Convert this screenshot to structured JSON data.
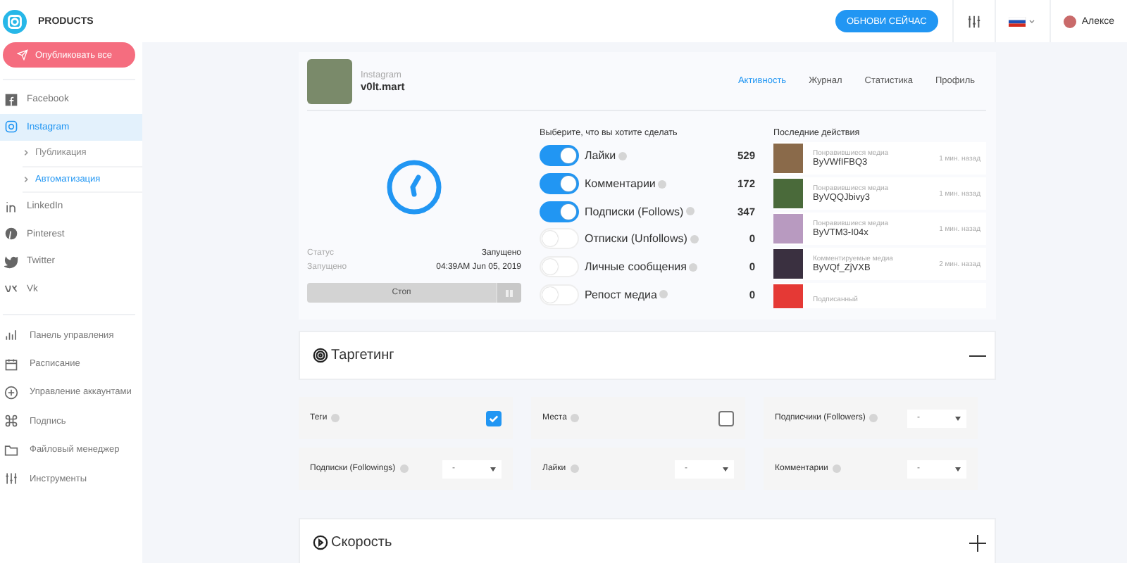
{
  "header": {
    "brand": "PRODUCTS",
    "update_button": "ОБНОВИ СЕЙЧАС",
    "user": "Алексе"
  },
  "sidebar": {
    "publish_button": "Опубликовать все",
    "networks": [
      {
        "label": "Facebook",
        "selected": false
      },
      {
        "label": "Instagram",
        "selected": true,
        "children": [
          {
            "label": "Публикация",
            "selected": false
          },
          {
            "label": "Автоматизация",
            "selected": true
          }
        ]
      },
      {
        "label": "LinkedIn",
        "selected": false
      },
      {
        "label": "Pinterest",
        "selected": false
      },
      {
        "label": "Twitter",
        "selected": false
      },
      {
        "label": "Vk",
        "selected": false
      }
    ],
    "tools": [
      {
        "label": "Панель управления"
      },
      {
        "label": "Расписание"
      },
      {
        "label": "Управление аккаунтами"
      },
      {
        "label": "Подпись"
      },
      {
        "label": "Файловый менеджер"
      },
      {
        "label": "Инструменты"
      }
    ]
  },
  "account": {
    "network": "Instagram",
    "username": "v0lt.mart"
  },
  "tabs": [
    {
      "label": "Активность",
      "selected": true
    },
    {
      "label": "Журнал",
      "selected": false
    },
    {
      "label": "Статистика",
      "selected": false
    },
    {
      "label": "Профиль",
      "selected": false
    }
  ],
  "status": [
    {
      "label": "Статус",
      "value": "Запущено"
    },
    {
      "label": "Запущено",
      "value": "04:39AM Jun 05, 2019"
    }
  ],
  "stop_button": "Стоп",
  "actions": {
    "title": "Выберите, что вы хотите сделать",
    "items": [
      {
        "label": "Лайки",
        "on": true,
        "count": "529"
      },
      {
        "label": "Комментарии",
        "on": true,
        "count": "172"
      },
      {
        "label": "Подписки (Follows)",
        "on": true,
        "count": "347"
      },
      {
        "label": "Отписки (Unfollows)",
        "on": false,
        "count": "0"
      },
      {
        "label": "Личные сообщения",
        "on": false,
        "count": "0"
      },
      {
        "label": "Репост медиа",
        "on": false,
        "count": "0"
      }
    ]
  },
  "recent": {
    "title": "Последние действия",
    "items": [
      {
        "type": "Понравившиеся медиа",
        "code": "ByVWfIFBQ3",
        "time": "1 мин. назад",
        "color": "#8a6a4a"
      },
      {
        "type": "Понравившиеся медиа",
        "code": "ByVQQJbivy3",
        "time": "1 мин. назад",
        "color": "#4a6a3a"
      },
      {
        "type": "Понравившиеся медиа",
        "code": "ByVTM3-I04x",
        "time": "1 мин. назад",
        "color": "#b89ac0"
      },
      {
        "type": "Комментируемые медиа",
        "code": "ByVQf_ZjVXB",
        "time": "2 мин. назад",
        "color": "#3a3040"
      },
      {
        "type": "Подписанный",
        "color": "#e53935"
      }
    ]
  },
  "targeting": {
    "title": "Таргетинг",
    "expanded": true,
    "fields": [
      {
        "kind": "checkbox",
        "label": "Теги",
        "checked": true
      },
      {
        "kind": "checkbox",
        "label": "Места",
        "checked": false
      },
      {
        "kind": "select",
        "label": "Подписчики (Followers)",
        "value": "-"
      },
      {
        "kind": "select",
        "label": "Подписки (Followings)",
        "value": "-"
      },
      {
        "kind": "select",
        "label": "Лайки",
        "value": "-"
      },
      {
        "kind": "select",
        "label": "Комментарии",
        "value": "-"
      }
    ]
  },
  "speed": {
    "title": "Скорость",
    "expanded": false
  }
}
